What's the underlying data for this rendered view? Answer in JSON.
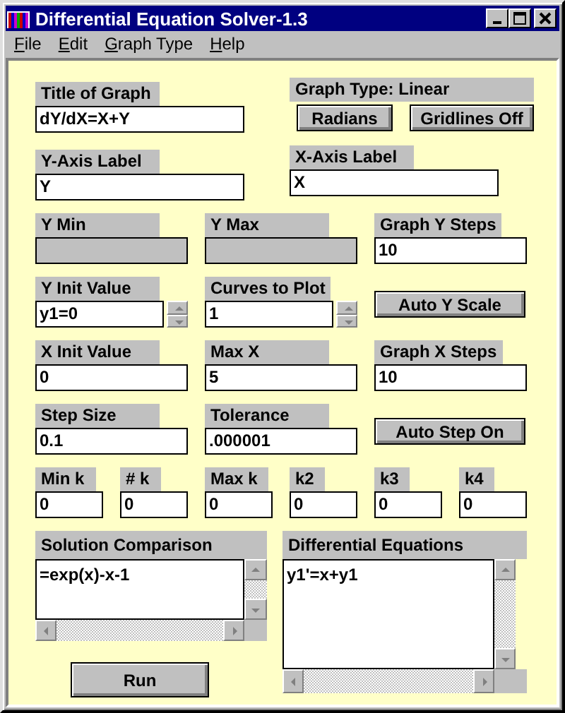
{
  "window": {
    "title": "Differential Equation Solver-1.3"
  },
  "menu": [
    {
      "label": "File"
    },
    {
      "label": "Edit"
    },
    {
      "label": "Graph Type"
    },
    {
      "label": "Help"
    }
  ],
  "rows": [
    [
      {
        "kind": "field",
        "label": "Title of Graph",
        "value": "dY/dX=X+Y",
        "disabled": false
      },
      {
        "kind": "button_group",
        "label": "Graph Type: Linear",
        "buttons": [
          "Radians",
          "Gridlines Off"
        ]
      }
    ],
    [
      {
        "kind": "field",
        "label": "Y-Axis Label",
        "value": "Y",
        "disabled": false
      },
      {
        "kind": "field",
        "label": "X-Axis Label",
        "value": "X",
        "disabled": false
      }
    ],
    [
      {
        "kind": "field",
        "label": "Y Min",
        "disabled": true
      },
      {
        "kind": "field",
        "label": "Y Max",
        "disabled": true
      },
      {
        "kind": "field",
        "label": "Graph Y Steps",
        "value": "10",
        "disabled": false
      }
    ],
    [
      {
        "kind": "spin",
        "label": "Y Init Value",
        "value": "y1=0"
      },
      {
        "kind": "spin",
        "label": "Curves to Plot",
        "value": "1"
      },
      {
        "kind": "button",
        "label": "Auto Y Scale"
      }
    ],
    [
      {
        "kind": "field",
        "label": "X Init Value",
        "value": "0",
        "disabled": false
      },
      {
        "kind": "field",
        "label": "Max X",
        "value": "5",
        "disabled": false
      },
      {
        "kind": "field",
        "label": "Graph X Steps",
        "value": "10",
        "disabled": false
      }
    ],
    [
      {
        "kind": "field",
        "label": "Step Size",
        "value": "0.1",
        "disabled": false
      },
      {
        "kind": "field",
        "label": "Tolerance",
        "value": ".000001",
        "disabled": false
      },
      {
        "kind": "button",
        "label": "Auto Step On"
      }
    ],
    [
      {
        "kind": "field",
        "label": "Min k",
        "value": "0",
        "disabled": false
      },
      {
        "kind": "field",
        "label": "# k",
        "value": "0",
        "disabled": false
      },
      {
        "kind": "field",
        "label": "Max k",
        "value": "0",
        "disabled": false
      },
      {
        "kind": "field",
        "label": "k2",
        "value": "0",
        "disabled": false
      },
      {
        "kind": "field",
        "label": "k3",
        "value": "0",
        "disabled": false
      },
      {
        "kind": "field",
        "label": "k4",
        "value": "0",
        "disabled": false
      }
    ]
  ],
  "solution_comparison": {
    "label": "Solution Comparison",
    "text": "=exp(x)-x-1"
  },
  "run_button": {
    "label": "Run"
  },
  "differential_equations": {
    "label": "Differential Equations",
    "text": "y1'=x+y1"
  }
}
